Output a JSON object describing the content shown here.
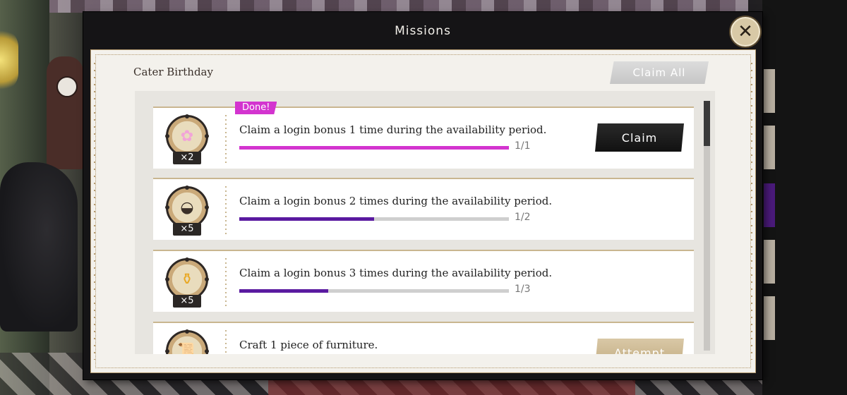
{
  "modal": {
    "title": "Missions",
    "close_icon": "close-icon"
  },
  "panel": {
    "section_title": "Cater Birthday",
    "claim_all_label": "Claim All"
  },
  "missions": [
    {
      "text": "Claim a login bonus 1 time during the availability period.",
      "progress_text": "1/1",
      "progress": 1.0,
      "progress_color": "#d334cf",
      "qty": "×2",
      "reward_icon": "flower-icon",
      "done_label": "Done!",
      "action_label": "Claim"
    },
    {
      "text": "Claim a login bonus 2 times during the availability period.",
      "progress_text": "1/2",
      "progress": 0.5,
      "progress_color": "#5a1aa0",
      "qty": "×5",
      "reward_icon": "dessert-plate-icon"
    },
    {
      "text": "Claim a login bonus 3 times during the availability period.",
      "progress_text": "1/3",
      "progress": 0.33,
      "progress_color": "#5a1aa0",
      "qty": "×5",
      "reward_icon": "honey-jar-icon"
    },
    {
      "text": "Craft 1 piece of furniture.",
      "reward_icon": "scroll-icon",
      "action_label": "Attempt"
    }
  ],
  "colors": {
    "accent_done": "#d334cf",
    "progress_purple": "#5a1aa0",
    "panel_bg": "#f3f1ec",
    "modal_bg": "#151416"
  }
}
